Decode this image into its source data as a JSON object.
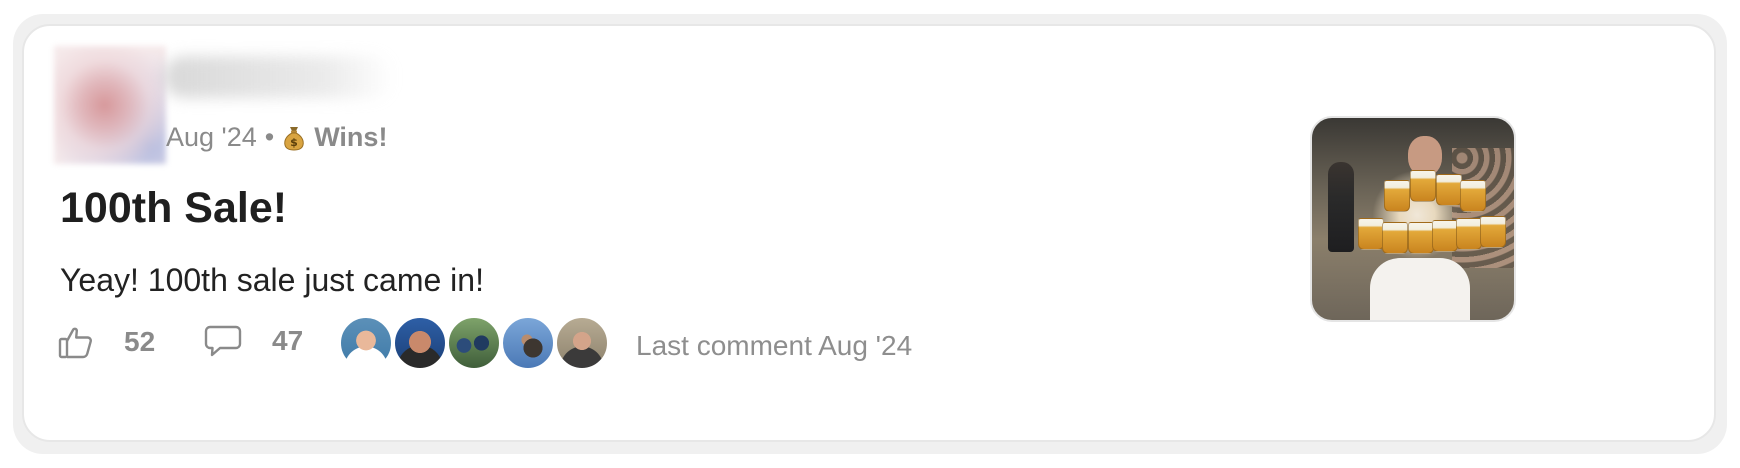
{
  "post": {
    "date": "Aug '24",
    "separator": "•",
    "category": "Wins!",
    "category_icon": "money-bag-icon",
    "title": "100th Sale!",
    "excerpt": "Yeay! 100th sale just came in!"
  },
  "stats": {
    "likes": "52",
    "comments": "47",
    "like_icon": "thumbs-up-icon",
    "comment_icon": "comment-bubble-icon"
  },
  "participants": [
    {
      "name": "participant-avatar-1"
    },
    {
      "name": "participant-avatar-2"
    },
    {
      "name": "participant-avatar-3"
    },
    {
      "name": "participant-avatar-4"
    },
    {
      "name": "participant-avatar-5"
    }
  ],
  "last_comment": "Last comment Aug '24",
  "colors": {
    "title": "#1f1f1f",
    "muted": "#8a8a8a",
    "card_border": "#e7e7e7"
  }
}
